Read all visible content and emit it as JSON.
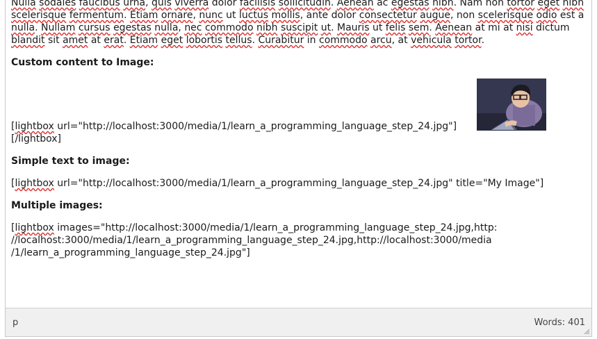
{
  "editor": {
    "intro_paragraph": [
      {
        "t": "Nulla",
        "s": true
      },
      {
        "t": " ",
        "s": false
      },
      {
        "t": "sodales",
        "s": true
      },
      {
        "t": " ",
        "s": false
      },
      {
        "t": "faucibus",
        "s": true
      },
      {
        "t": " ",
        "s": false
      },
      {
        "t": "urna",
        "s": true
      },
      {
        "t": ", ",
        "s": false
      },
      {
        "t": "quis",
        "s": true
      },
      {
        "t": " ",
        "s": false
      },
      {
        "t": "viverra",
        "s": true
      },
      {
        "t": " dolor ",
        "s": false
      },
      {
        "t": "facilisis",
        "s": true
      },
      {
        "t": " ",
        "s": false
      },
      {
        "t": "sollicitudin",
        "s": true
      },
      {
        "t": ". ",
        "s": false
      },
      {
        "t": "Aenean",
        "s": true
      },
      {
        "t": " ac ",
        "s": false
      },
      {
        "t": "egestas",
        "s": true
      },
      {
        "t": " ",
        "s": false
      },
      {
        "t": "nibh",
        "s": true
      },
      {
        "t": ". Nam non ",
        "s": false
      },
      {
        "t": "tortor",
        "s": true
      },
      {
        "t": " ",
        "s": false
      },
      {
        "t": "eget",
        "s": true
      },
      {
        "t": " ",
        "s": false
      },
      {
        "t": "nibh",
        "s": true
      },
      {
        "t": " ",
        "s": false
      },
      {
        "t": "scelerisque",
        "s": true
      },
      {
        "t": " ",
        "s": false
      },
      {
        "t": "fermentum",
        "s": true
      },
      {
        "t": ". ",
        "s": false
      },
      {
        "t": "Etiam",
        "s": true
      },
      {
        "t": " ",
        "s": false
      },
      {
        "t": "ornare",
        "s": true
      },
      {
        "t": ", ",
        "s": false
      },
      {
        "t": "nunc",
        "s": true
      },
      {
        "t": " ut ",
        "s": false
      },
      {
        "t": "luctus",
        "s": true
      },
      {
        "t": " ",
        "s": false
      },
      {
        "t": "mollis",
        "s": true
      },
      {
        "t": ", ante dolor ",
        "s": false
      },
      {
        "t": "consectetur",
        "s": true
      },
      {
        "t": " ",
        "s": false
      },
      {
        "t": "augue",
        "s": true
      },
      {
        "t": ", non ",
        "s": false
      },
      {
        "t": "scelerisque",
        "s": true
      },
      {
        "t": " ",
        "s": false
      },
      {
        "t": "odio",
        "s": true
      },
      {
        "t": " est a ",
        "s": false
      },
      {
        "t": "nulla",
        "s": true
      },
      {
        "t": ". ",
        "s": false
      },
      {
        "t": "Nullam",
        "s": true
      },
      {
        "t": " ",
        "s": false
      },
      {
        "t": "cursus",
        "s": true
      },
      {
        "t": " ",
        "s": false
      },
      {
        "t": "egestas",
        "s": true
      },
      {
        "t": " ",
        "s": false
      },
      {
        "t": "nulla",
        "s": true
      },
      {
        "t": ", ",
        "s": false
      },
      {
        "t": "nec",
        "s": true
      },
      {
        "t": " ",
        "s": false
      },
      {
        "t": "commodo",
        "s": true
      },
      {
        "t": " ",
        "s": false
      },
      {
        "t": "nibh",
        "s": true
      },
      {
        "t": " ",
        "s": false
      },
      {
        "t": "suscipit",
        "s": true
      },
      {
        "t": " ",
        "s": false
      },
      {
        "t": "ut",
        "s": true
      },
      {
        "t": ". ",
        "s": false
      },
      {
        "t": "Mauris",
        "s": true
      },
      {
        "t": " ut ",
        "s": false
      },
      {
        "t": "felis",
        "s": true
      },
      {
        "t": " ",
        "s": false
      },
      {
        "t": "sem",
        "s": true
      },
      {
        "t": ". ",
        "s": false
      },
      {
        "t": "Aenean",
        "s": true
      },
      {
        "t": " at mi at ",
        "s": false
      },
      {
        "t": "nisi",
        "s": true
      },
      {
        "t": " dictum ",
        "s": false
      },
      {
        "t": "blandit",
        "s": true
      },
      {
        "t": " sit ",
        "s": false
      },
      {
        "t": "amet",
        "s": true
      },
      {
        "t": " at ",
        "s": false
      },
      {
        "t": "erat",
        "s": true
      },
      {
        "t": ". ",
        "s": false
      },
      {
        "t": "Etiam",
        "s": true
      },
      {
        "t": " ",
        "s": false
      },
      {
        "t": "eget",
        "s": true
      },
      {
        "t": " ",
        "s": false
      },
      {
        "t": "lobortis",
        "s": true
      },
      {
        "t": " ",
        "s": false
      },
      {
        "t": "tellus",
        "s": true
      },
      {
        "t": ". ",
        "s": false
      },
      {
        "t": "Curabitur",
        "s": true
      },
      {
        "t": " in ",
        "s": false
      },
      {
        "t": "commodo",
        "s": true
      },
      {
        "t": " ",
        "s": false
      },
      {
        "t": "arcu",
        "s": true
      },
      {
        "t": ", at ",
        "s": false
      },
      {
        "t": "vehicula",
        "s": true
      },
      {
        "t": " ",
        "s": false
      },
      {
        "t": "tortor",
        "s": true
      },
      {
        "t": ".",
        "s": false
      }
    ],
    "sections": {
      "custom_content": {
        "heading": "Custom content to Image:",
        "open_tag": "lightbox",
        "line1_rest": " url=\"http://localhost:3000/media/1/learn_a_programming_language_step_24.jpg\"]",
        "line2": "[/lightbox]"
      },
      "simple_text": {
        "heading": "Simple text to image:",
        "open_tag": "lightbox",
        "line1_rest": " url=\"http://localhost:3000/media/1/learn_a_programming_language_step_24.jpg\" title=\"My Image\"]"
      },
      "multiple_images": {
        "heading": "Multiple images:",
        "open_tag": "lightbox",
        "line1_rest": " images=\"http://localhost:3000/media/1/learn_a_programming_language_step_24.jpg,http:",
        "line2": "//localhost:3000/media/1/learn_a_programming_language_step_24.jpg,http://localhost:3000/media",
        "line3": "/1/learn_a_programming_language_step_24.jpg\"]"
      }
    },
    "statusbar": {
      "path": "p",
      "word_count": "Words: 401"
    }
  }
}
